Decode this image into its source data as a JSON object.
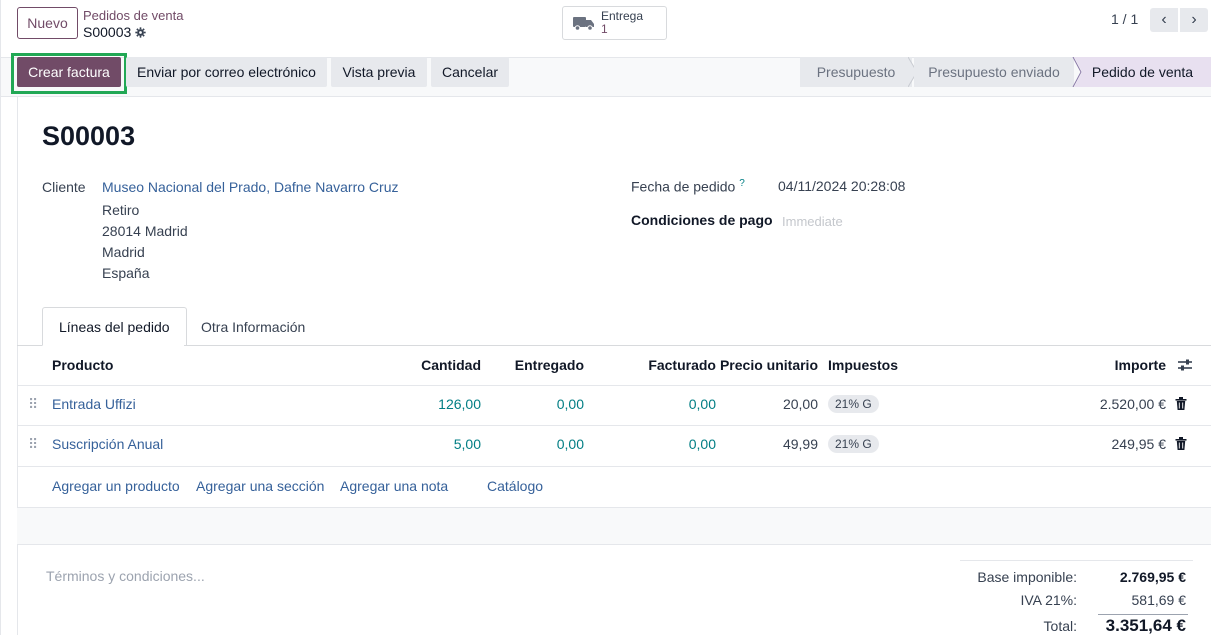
{
  "control": {
    "new_label": "Nuevo",
    "breadcrumb_parent": "Pedidos de venta",
    "breadcrumb_current": "S00003",
    "gear_icon": "gear-icon",
    "smart_button": {
      "label": "Entrega",
      "count": "1",
      "icon": "truck-icon"
    },
    "pager": "1 / 1"
  },
  "actions": {
    "create_invoice": "Crear factura",
    "send_email": "Enviar por correo electrónico",
    "preview": "Vista previa",
    "cancel": "Cancelar"
  },
  "stages": [
    "Presupuesto",
    "Presupuesto enviado",
    "Pedido de venta"
  ],
  "active_stage": "Pedido de venta",
  "form": {
    "title": "S00003",
    "customer_label": "Cliente",
    "customer_name": "Museo Nacional del Prado, Dafne Navarro Cruz",
    "address": [
      "Retiro",
      "28014 Madrid",
      "Madrid",
      "España"
    ],
    "order_date_label": "Fecha de pedido",
    "order_date_help": "?",
    "order_date": "04/11/2024 20:28:08",
    "payment_terms_label": "Condiciones de pago",
    "payment_terms_placeholder": "Immediate"
  },
  "tabs": [
    "Líneas del pedido",
    "Otra Información"
  ],
  "table": {
    "headers": {
      "product": "Producto",
      "quantity": "Cantidad",
      "delivered": "Entregado",
      "invoiced": "Facturado",
      "unit_price": "Precio unitario",
      "taxes": "Impuestos",
      "amount": "Importe"
    },
    "rows": [
      {
        "product": "Entrada Uffizi",
        "quantity": "126,00",
        "delivered": "0,00",
        "invoiced": "0,00",
        "unit_price": "20,00",
        "tax": "21% G",
        "amount": "2.520,00 €"
      },
      {
        "product": "Suscripción Anual",
        "quantity": "5,00",
        "delivered": "0,00",
        "invoiced": "0,00",
        "unit_price": "49,99",
        "tax": "21% G",
        "amount": "249,95 €"
      }
    ],
    "add_product": "Agregar un producto",
    "add_section": "Agregar una sección",
    "add_note": "Agregar una nota",
    "catalog": "Catálogo"
  },
  "terms_placeholder": "Términos y condiciones...",
  "totals": {
    "base_label": "Base imponible:",
    "base_value": "2.769,95 €",
    "tax_label": "IVA 21%:",
    "tax_value": "581,69 €",
    "total_label": "Total:",
    "total_value": "3.351,64 €"
  },
  "colors": {
    "brand": "#714B67",
    "link": "#36619a",
    "numeric_link": "#017e84",
    "highlight": "#22a855"
  }
}
